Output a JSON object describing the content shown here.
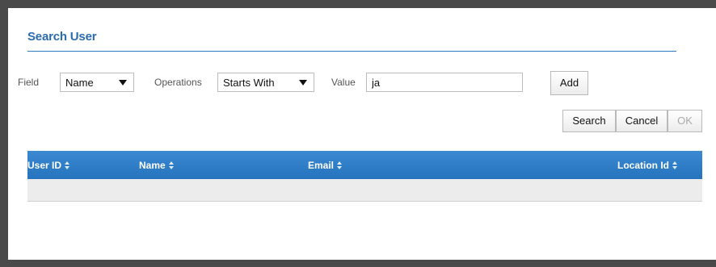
{
  "dialog": {
    "title": "Search User"
  },
  "filter": {
    "field_label": "Field",
    "field_value": "Name",
    "operations_label": "Operations",
    "operations_value": "Starts With",
    "value_label": "Value",
    "value_input": "ja",
    "add_label": "Add"
  },
  "actions": {
    "search_label": "Search",
    "cancel_label": "Cancel",
    "ok_label": "OK"
  },
  "grid": {
    "columns": [
      "User ID",
      "Name",
      "Email",
      "Location Id"
    ],
    "rows": []
  },
  "icons": {
    "sort": "sort-icon",
    "dropdown": "caret-down-icon"
  },
  "colors": {
    "accent": "#2b78c5",
    "header_bg": "#2f7dc6",
    "row_bg": "#ececec"
  }
}
